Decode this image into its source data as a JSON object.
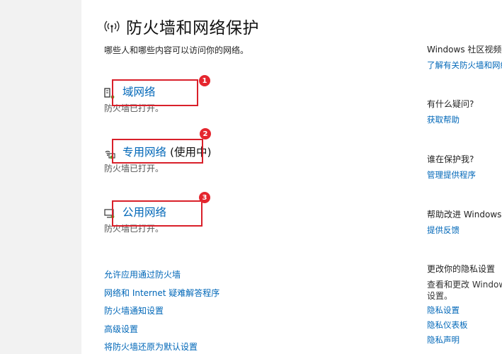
{
  "header": {
    "title": "防火墙和网络保护",
    "subtitle": "哪些人和哪些内容可以访问你的网络。",
    "icon": "wifi-antenna-icon"
  },
  "networks": [
    {
      "name": "域网络",
      "suffix": "",
      "status": "防火墙已打开。",
      "icon": "domain-network-icon",
      "badge": "1"
    },
    {
      "name": "专用网络",
      "suffix": "(使用中)",
      "status": "防火墙已打开。",
      "icon": "private-network-icon",
      "badge": "2"
    },
    {
      "name": "公用网络",
      "suffix": "",
      "status": "防火墙已打开。",
      "icon": "public-network-icon",
      "badge": "3"
    }
  ],
  "links": [
    "允许应用通过防火墙",
    "网络和 Internet 疑难解答程序",
    "防火墙通知设置",
    "高级设置",
    "将防火墙还原为默认设置"
  ],
  "sidebar": {
    "community": {
      "heading": "Windows 社区视频",
      "link": "了解有关防火墙和网络"
    },
    "question": {
      "heading": "有什么疑问?",
      "link": "获取帮助"
    },
    "protect": {
      "heading": "谁在保护我?",
      "link": "管理提供程序"
    },
    "improve": {
      "heading": "帮助改进 Windows",
      "link": "提供反馈"
    },
    "privacy": {
      "heading": "更改你的隐私设置",
      "text_line1": "查看和更改 Window",
      "text_line2": "设置。",
      "links": [
        "隐私设置",
        "隐私仪表板",
        "隐私声明"
      ]
    }
  },
  "colors": {
    "link": "#0067b8",
    "annotation": "#d9202a",
    "badge": "#e5262e"
  }
}
